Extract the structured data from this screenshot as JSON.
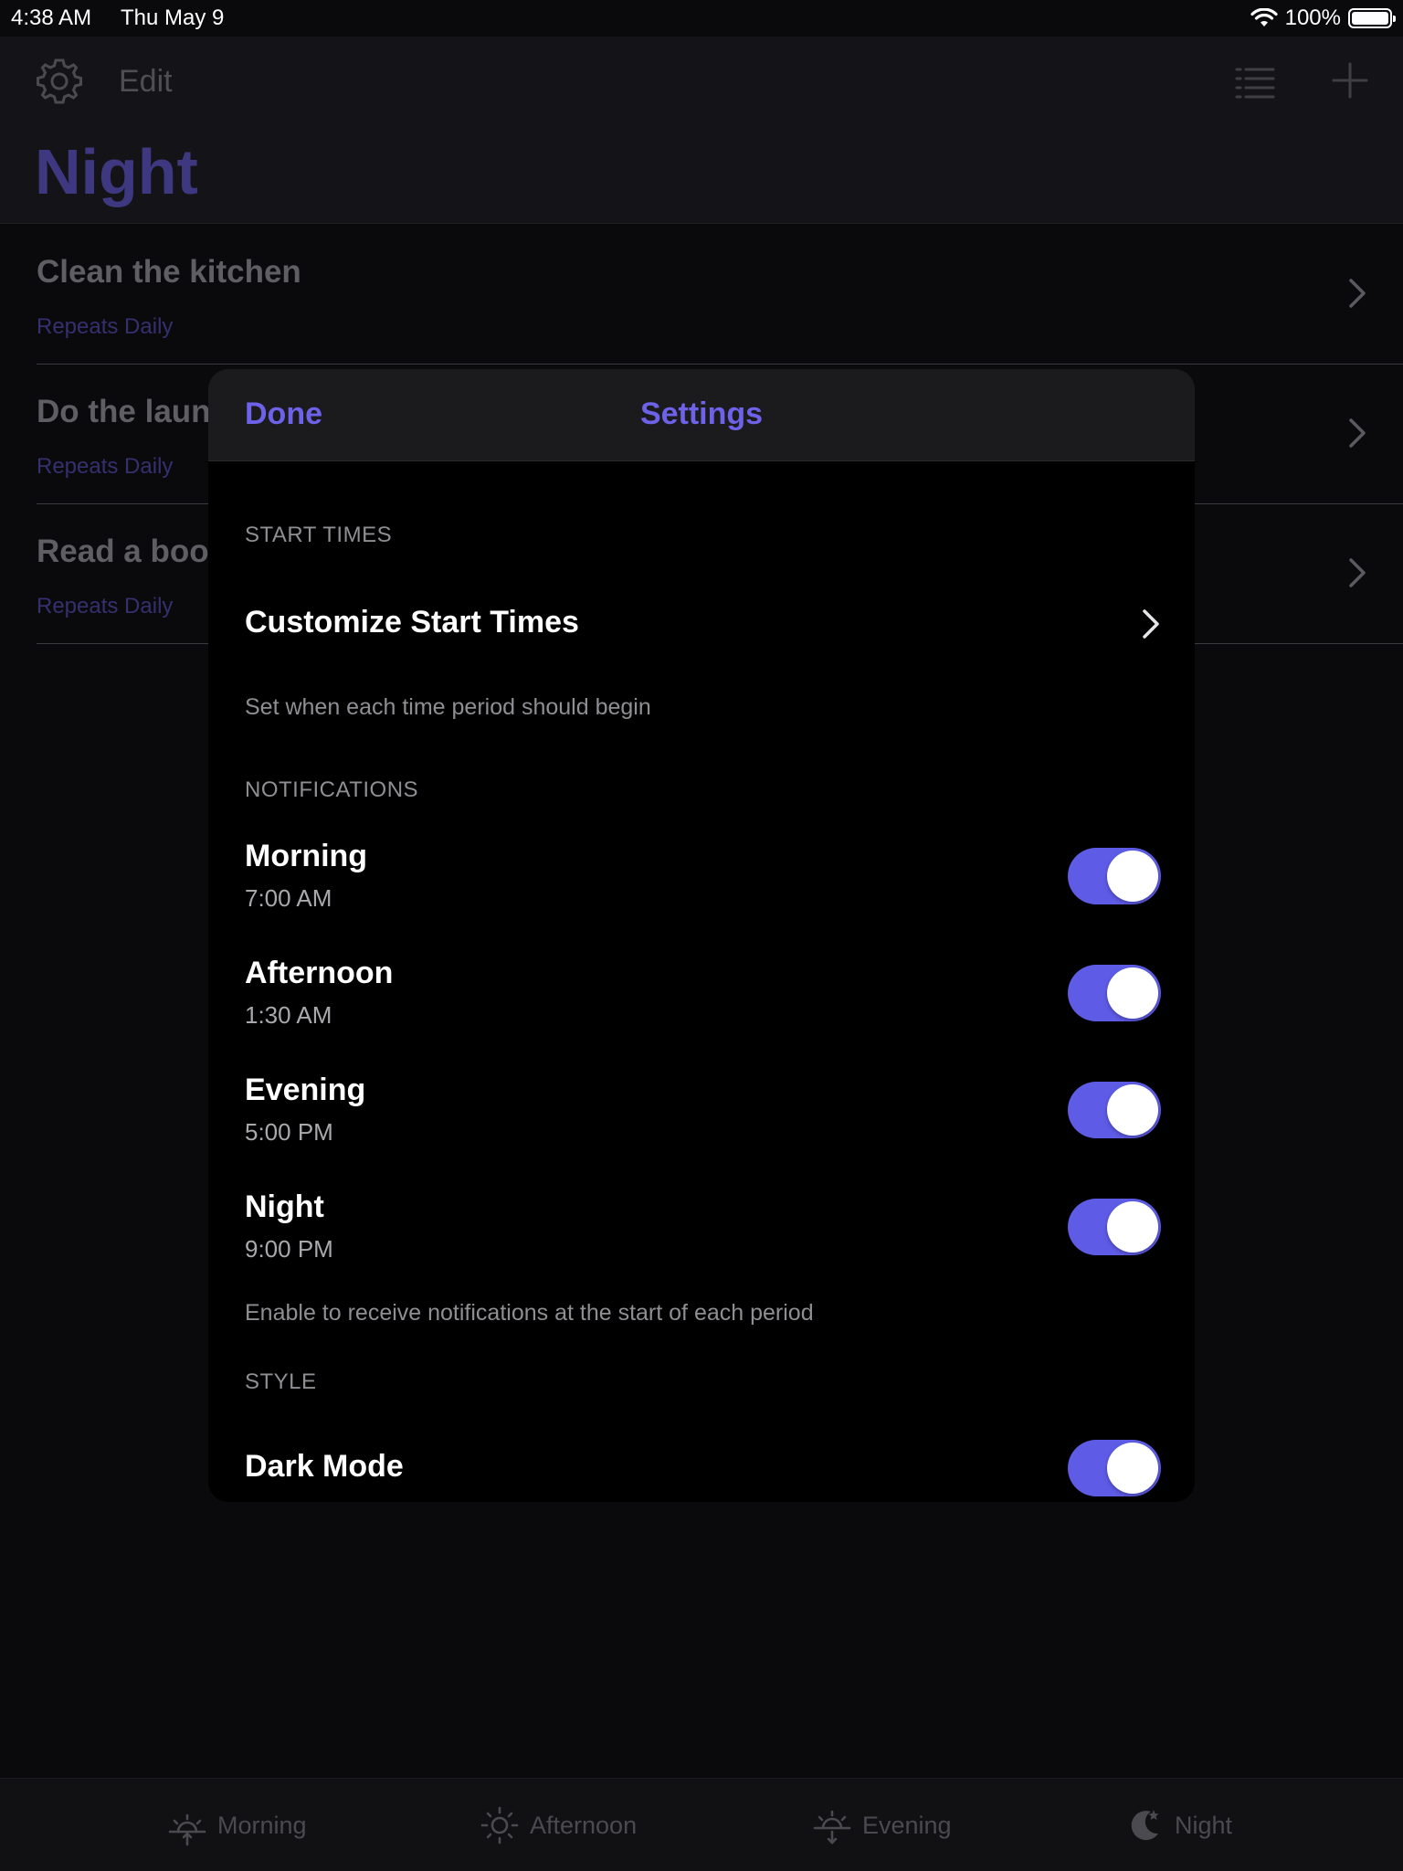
{
  "status_bar": {
    "time": "4:38 AM",
    "date": "Thu May 9",
    "battery": "100%"
  },
  "header": {
    "edit_label": "Edit",
    "title": "Night"
  },
  "tasks": [
    {
      "title": "Clean the kitchen",
      "repeat": "Repeats Daily"
    },
    {
      "title": "Do the laundry",
      "repeat": "Repeats Daily"
    },
    {
      "title": "Read a book",
      "repeat": "Repeats Daily"
    }
  ],
  "tabs": [
    {
      "label": "Morning",
      "icon": "sunrise-icon"
    },
    {
      "label": "Afternoon",
      "icon": "sun-icon"
    },
    {
      "label": "Evening",
      "icon": "sunset-icon"
    },
    {
      "label": "Night",
      "icon": "moon-icon"
    }
  ],
  "settings": {
    "done_label": "Done",
    "title": "Settings",
    "start_times": {
      "header": "START TIMES",
      "customize_label": "Customize Start Times",
      "footer": "Set when each time period should begin"
    },
    "notifications": {
      "header": "NOTIFICATIONS",
      "items": [
        {
          "label": "Morning",
          "time": "7:00 AM",
          "enabled": true
        },
        {
          "label": "Afternoon",
          "time": "1:30 AM",
          "enabled": true
        },
        {
          "label": "Evening",
          "time": "5:00 PM",
          "enabled": true
        },
        {
          "label": "Night",
          "time": "9:00 PM",
          "enabled": true
        }
      ],
      "footer": "Enable to receive notifications at the start of each period"
    },
    "style": {
      "header": "STYLE",
      "dark_mode_label": "Dark Mode",
      "dark_mode_enabled": true
    }
  },
  "colors": {
    "accent": "#5e5ce6",
    "title_dim": "#3e3880",
    "background": "#0a0a0d"
  }
}
